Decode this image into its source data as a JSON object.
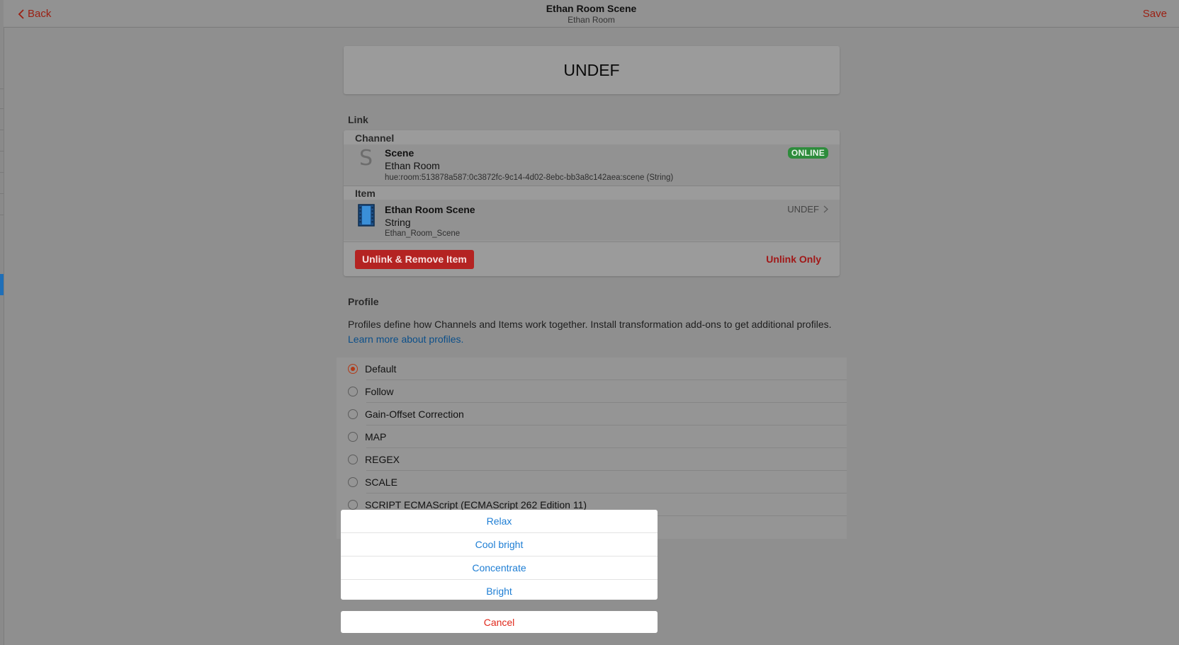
{
  "navbar": {
    "back_label": "Back",
    "title": "Ethan Room Scene",
    "subtitle": "Ethan Room",
    "save_label": "Save"
  },
  "state": "UNDEF",
  "link": {
    "section_title": "Link",
    "channel_header": "Channel",
    "channel": {
      "icon_letter": "S",
      "name": "Scene",
      "location": "Ethan Room",
      "uid": "hue:room:513878a587:0c3872fc-9c14-4d02-8ebc-bb3a8c142aea:scene (String)",
      "status": "ONLINE"
    },
    "item_header": "Item",
    "item": {
      "icon": "film-strip-icon",
      "label": "Ethan Room Scene",
      "type": "String",
      "name": "Ethan_Room_Scene",
      "state": "UNDEF"
    },
    "unlink_remove_label": "Unlink & Remove Item",
    "unlink_only_label": "Unlink Only"
  },
  "profile": {
    "section_title": "Profile",
    "description": "Profiles define how Channels and Items work together. Install transformation add-ons to get additional profiles.",
    "learn_more": "Learn more about profiles.",
    "options": [
      {
        "label": "Default",
        "selected": true
      },
      {
        "label": "Follow",
        "selected": false
      },
      {
        "label": "Gain-Offset Correction",
        "selected": false
      },
      {
        "label": "MAP",
        "selected": false
      },
      {
        "label": "REGEX",
        "selected": false
      },
      {
        "label": "SCALE",
        "selected": false
      },
      {
        "label": "SCRIPT ECMAScript (ECMAScript 262 Edition 11)",
        "selected": false
      }
    ]
  },
  "action_sheet": {
    "options": [
      "Relax",
      "Cool bright",
      "Concentrate",
      "Bright"
    ],
    "cancel_label": "Cancel"
  },
  "colors": {
    "accent_red": "#b42322",
    "link_blue": "#1e7ed4",
    "online_green": "#2e8c3c"
  }
}
